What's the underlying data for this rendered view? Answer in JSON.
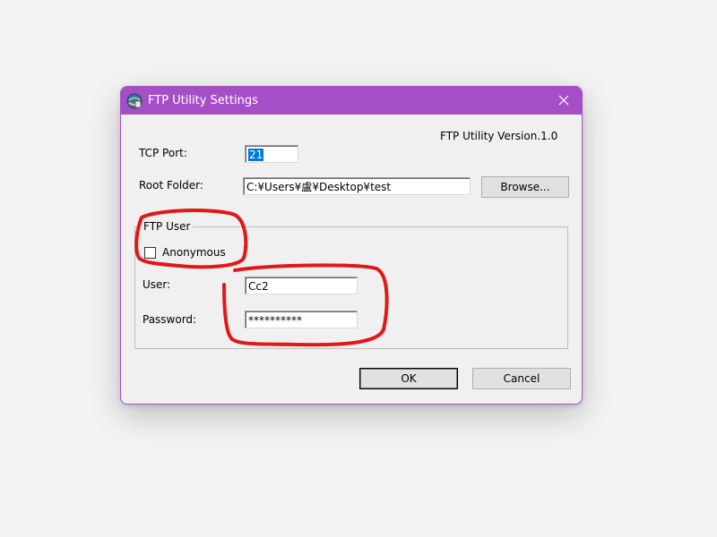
{
  "window": {
    "title": "FTP Utility Settings",
    "accent_color": "#a54fc7",
    "icon": "ftp-app-icon",
    "close_icon": "close-icon"
  },
  "version_label": "FTP Utility Version.1.0",
  "tcp_port": {
    "label": "TCP Port:",
    "value": "21"
  },
  "root_folder": {
    "label": "Root Folder:",
    "value": "C:¥Users¥",
    "value_glyph": "盧",
    "value_rest": "¥Desktop¥test",
    "browse_label": "Browse..."
  },
  "ftp_user_group": {
    "title": "FTP User",
    "anonymous_label": "Anonymous",
    "anonymous_checked": false,
    "user_label": "User:",
    "user_value": "Cc2",
    "password_label": "Password:",
    "password_value": "**********"
  },
  "buttons": {
    "ok_label": "OK",
    "cancel_label": "Cancel"
  },
  "annotation_color": "#e21818"
}
